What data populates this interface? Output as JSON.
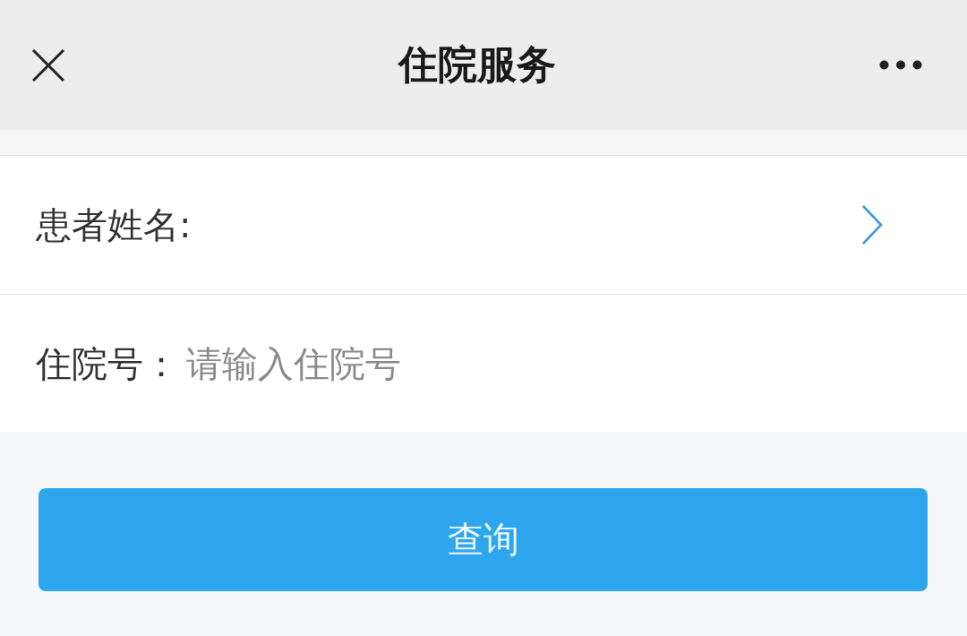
{
  "header": {
    "title": "住院服务"
  },
  "form": {
    "fields": [
      {
        "kind": "picker",
        "label": "患者姓名:"
      },
      {
        "kind": "text",
        "label": "住院号：",
        "placeholder": "请输入住院号"
      }
    ]
  },
  "submit_button": {
    "label": "查询"
  }
}
